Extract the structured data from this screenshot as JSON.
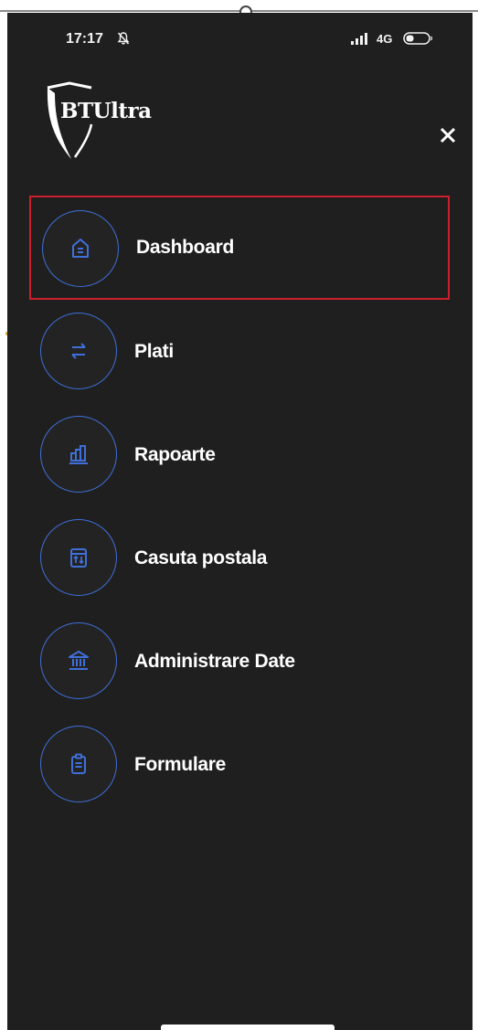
{
  "status_bar": {
    "time": "17:17",
    "network": "4G",
    "icons": [
      "silent-bell-icon",
      "signal-bars-icon",
      "battery-icon"
    ]
  },
  "app": {
    "logo_text": "BTUltra",
    "close_icon": "close-icon"
  },
  "menu": {
    "selected": "Dashboard",
    "items": [
      {
        "label": "Dashboard",
        "icon": "home-icon"
      },
      {
        "label": "Plati",
        "icon": "transfer-arrows-icon"
      },
      {
        "label": "Rapoarte",
        "icon": "bar-chart-icon"
      },
      {
        "label": "Casuta postala",
        "icon": "mailbox-icon"
      },
      {
        "label": "Administrare Date",
        "icon": "bank-building-icon"
      },
      {
        "label": "Formulare",
        "icon": "clipboard-icon"
      }
    ]
  },
  "colors": {
    "background": "#1f1f1f",
    "icon_accent": "#3f6fd8",
    "selection_border": "#cc1f2e",
    "text": "#ffffff"
  }
}
